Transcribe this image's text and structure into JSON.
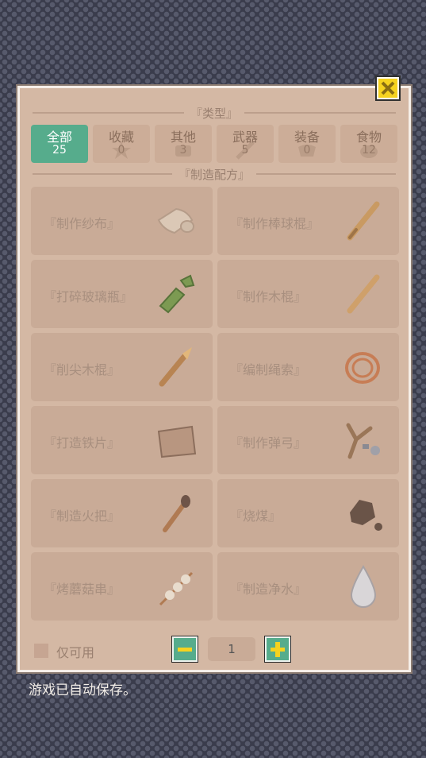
{
  "panel": {
    "type_header": "『类型』",
    "recipe_header": "『制造配方』"
  },
  "tabs": [
    {
      "label": "全部",
      "count": "25",
      "icon": "all-icon",
      "active": true
    },
    {
      "label": "收藏",
      "count": "0",
      "icon": "star-icon",
      "active": false
    },
    {
      "label": "其他",
      "count": "3",
      "icon": "misc-icon",
      "active": false
    },
    {
      "label": "武器",
      "count": "5",
      "icon": "weapon-icon",
      "active": false
    },
    {
      "label": "装备",
      "count": "0",
      "icon": "armor-icon",
      "active": false
    },
    {
      "label": "食物",
      "count": "12",
      "icon": "food-icon",
      "active": false
    }
  ],
  "recipes": [
    {
      "name": "『制作纱布』",
      "icon": "gauze-icon"
    },
    {
      "name": "『制作棒球棍』",
      "icon": "baseball-bat-icon"
    },
    {
      "name": "『打碎玻璃瓶』",
      "icon": "broken-bottle-icon"
    },
    {
      "name": "『制作木棍』",
      "icon": "wooden-stick-icon"
    },
    {
      "name": "『削尖木棍』",
      "icon": "sharpened-stick-icon"
    },
    {
      "name": "『编制绳索』",
      "icon": "rope-icon"
    },
    {
      "name": "『打造铁片』",
      "icon": "iron-sheet-icon"
    },
    {
      "name": "『制作弹弓』",
      "icon": "slingshot-icon"
    },
    {
      "name": "『制造火把』",
      "icon": "torch-icon"
    },
    {
      "name": "『烧煤』",
      "icon": "coal-icon"
    },
    {
      "name": "『烤蘑菇串』",
      "icon": "mushroom-skewer-icon"
    },
    {
      "name": "『制造净水』",
      "icon": "water-drop-icon"
    }
  ],
  "footer": {
    "only_available_label": "仅可用",
    "only_available_checked": false,
    "quantity": "1"
  },
  "status": "游戏已自动保存。",
  "colors": {
    "accent": "#56ac8c",
    "highlight": "#f6d21f",
    "panel": "#d4b8a4"
  }
}
